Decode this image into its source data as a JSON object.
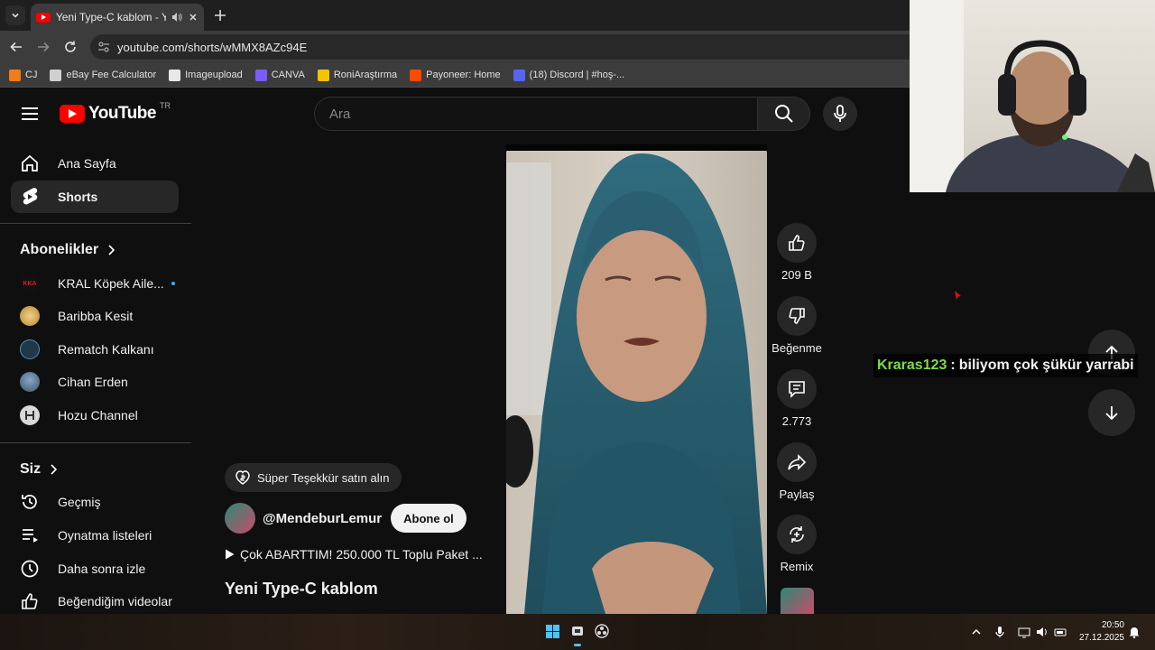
{
  "browser": {
    "tab_title": "Yeni Type-C kablom - YouTube",
    "url": "youtube.com/shorts/wMMX8AZc94E",
    "bookmarks": [
      {
        "label": "CJ",
        "color": "#f07c1a"
      },
      {
        "label": "eBay Fee Calculator",
        "color": "#d0d0d0"
      },
      {
        "label": "Imageupload",
        "color": "#e8e8e8"
      },
      {
        "label": "CANVA",
        "color": "#7b5cff"
      },
      {
        "label": "RoniAraştırma",
        "color": "#f2c300"
      },
      {
        "label": "Payoneer: Home",
        "color": "#ff4800"
      },
      {
        "label": "(18) Discord | #hoş-...",
        "color": "#5865f2"
      }
    ]
  },
  "youtube": {
    "logo_text": "YouTube",
    "country_code": "TR",
    "search_placeholder": "Ara",
    "accent": "#ff0000"
  },
  "sidebar": {
    "main": [
      {
        "label": "Ana Sayfa",
        "icon": "home-icon"
      },
      {
        "label": "Shorts",
        "icon": "shorts-icon",
        "active": true
      }
    ],
    "subscriptions_header": "Abonelikler",
    "subscriptions": [
      {
        "label": "KRAL Köpek Aile...",
        "avatar_text": "KKA",
        "live": true
      },
      {
        "label": "Baribba Kesit"
      },
      {
        "label": "Rematch Kalkanı"
      },
      {
        "label": "Cihan Erden"
      },
      {
        "label": "Hozu Channel"
      }
    ],
    "you_header": "Siz",
    "you": [
      {
        "label": "Geçmiş",
        "icon": "history-icon"
      },
      {
        "label": "Oynatma listeleri",
        "icon": "playlists-icon"
      },
      {
        "label": "Daha sonra izle",
        "icon": "watch-later-icon"
      },
      {
        "label": "Beğendiğim videolar",
        "icon": "liked-icon"
      }
    ]
  },
  "short": {
    "super_thanks_label": "Süper Teşekkür satın alın",
    "channel_handle": "@MendeburLemur",
    "subscribe_label": "Abone ol",
    "playlist_text": "Çok ABARTTIM! 250.000 TL Toplu Paket ...",
    "title": "Yeni Type-C kablom",
    "likes": "209 B",
    "dislike_label": "Beğenme",
    "comments": "2.773",
    "share_label": "Paylaş",
    "remix_label": "Remix"
  },
  "chat": {
    "username": "Kraras123",
    "separator": ":",
    "message": "biliyom çok şükür yarrabi"
  },
  "taskbar": {
    "time": "20:50",
    "date": "27.12.2025"
  }
}
